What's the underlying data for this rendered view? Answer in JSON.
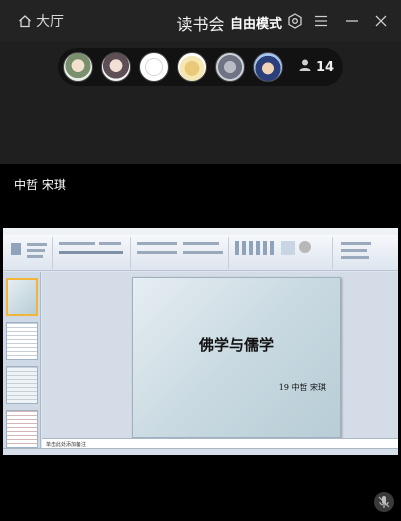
{
  "header": {
    "hall_label": "大厅",
    "title": "读书会",
    "mode_label": "自由模式",
    "icons": [
      "home-icon",
      "settings-icon",
      "menu-icon",
      "minimize-icon",
      "close-icon"
    ]
  },
  "members": {
    "avatars": [
      "avatar-1",
      "avatar-2",
      "avatar-3",
      "avatar-4",
      "avatar-5",
      "avatar-6"
    ],
    "count": "14"
  },
  "presenter": "中哲 宋琪",
  "slideshow": {
    "slide_title": "佛学与儒学",
    "slide_subtitle": "19 中哲 宋琪",
    "notes_placeholder": "单击此处添加备注"
  },
  "colors": {
    "background": "#000000",
    "topbar": "#232323",
    "band": "#1f1f1f"
  }
}
